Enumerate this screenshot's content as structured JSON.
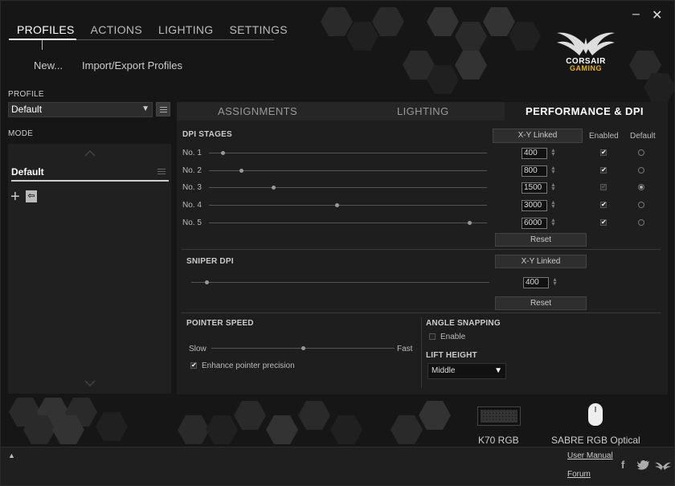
{
  "window": {
    "minimize_glyph": "–",
    "close_glyph": "✕"
  },
  "topnav": {
    "tabs": [
      "PROFILES",
      "ACTIONS",
      "LIGHTING",
      "SETTINGS"
    ],
    "active": "PROFILES"
  },
  "subnav": {
    "new_label": "New...",
    "import_export_label": "Import/Export Profiles"
  },
  "brand": {
    "line1": "CORSAIR",
    "line2": "GAMING",
    "accent": "#e8b21a"
  },
  "profile": {
    "section_label": "PROFILE",
    "selected": "Default"
  },
  "mode": {
    "section_label": "MODE",
    "items": [
      "Default"
    ],
    "add_glyph": "+",
    "import_glyph": "⇦"
  },
  "tabs": {
    "items": [
      "ASSIGNMENTS",
      "LIGHTING",
      "PERFORMANCE & DPI"
    ],
    "active": "PERFORMANCE & DPI"
  },
  "dpi_stages": {
    "title": "DPI STAGES",
    "xy_linked_label": "X-Y Linked",
    "enabled_header": "Enabled",
    "default_header": "Default",
    "reset_label": "Reset",
    "stages": [
      {
        "label": "No. 1",
        "value": "400",
        "enabled": true,
        "default": false,
        "slider": 0.05
      },
      {
        "label": "No. 2",
        "value": "800",
        "enabled": true,
        "default": false,
        "slider": 0.115
      },
      {
        "label": "No. 3",
        "value": "1500",
        "enabled": true,
        "default": true,
        "slider": 0.23
      },
      {
        "label": "No. 4",
        "value": "3000",
        "enabled": true,
        "default": false,
        "slider": 0.46
      },
      {
        "label": "No. 5",
        "value": "6000",
        "enabled": true,
        "default": false,
        "slider": 0.935
      }
    ]
  },
  "sniper_dpi": {
    "title": "SNIPER DPI",
    "xy_linked_label": "X-Y Linked",
    "value": "400",
    "reset_label": "Reset",
    "slider": 0.05
  },
  "pointer_speed": {
    "title": "POINTER SPEED",
    "slow_label": "Slow",
    "fast_label": "Fast",
    "slider": 0.5,
    "enhance_label": "Enhance pointer precision",
    "enhance_checked": true
  },
  "angle_snapping": {
    "title": "ANGLE SNAPPING",
    "enable_label": "Enable",
    "enabled": false
  },
  "lift_height": {
    "title": "LIFT HEIGHT",
    "selected": "Middle"
  },
  "devices": [
    {
      "name": "K70 RGB",
      "icon": "keyboard-icon"
    },
    {
      "name": "SABRE RGB Optical",
      "icon": "mouse-icon"
    }
  ],
  "footer": {
    "user_manual_label": "User Manual",
    "forum_label": "Forum",
    "collapse_glyph": "▲"
  }
}
